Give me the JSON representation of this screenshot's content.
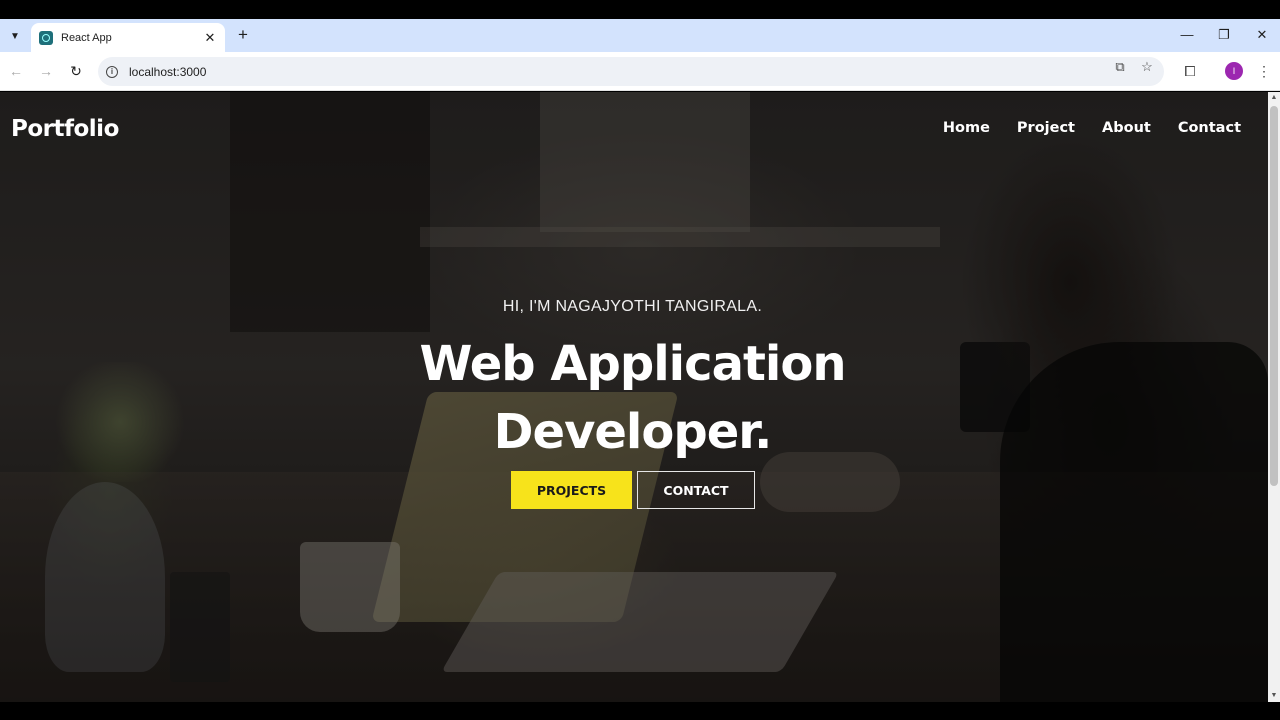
{
  "browser": {
    "tab_title": "React App",
    "tab_close": "✕",
    "new_tab": "+",
    "url": "localhost:3000",
    "window_controls": {
      "minimize": "—",
      "restore": "❐",
      "close": "✕"
    },
    "profile_initial": "I",
    "profile_color": "#9c27b0"
  },
  "site": {
    "brand": "Portfolio",
    "nav": [
      {
        "label": "Home"
      },
      {
        "label": "Project"
      },
      {
        "label": "About"
      },
      {
        "label": "Contact"
      }
    ],
    "hero": {
      "greeting": "HI, I'M NAGAJYOTHI TANGIRALA.",
      "title_line1": "Web Application",
      "title_line2": "Developer."
    },
    "buttons": {
      "primary": "PROJECTS",
      "secondary": "CONTACT"
    },
    "colors": {
      "accent": "#f7e31b"
    }
  }
}
